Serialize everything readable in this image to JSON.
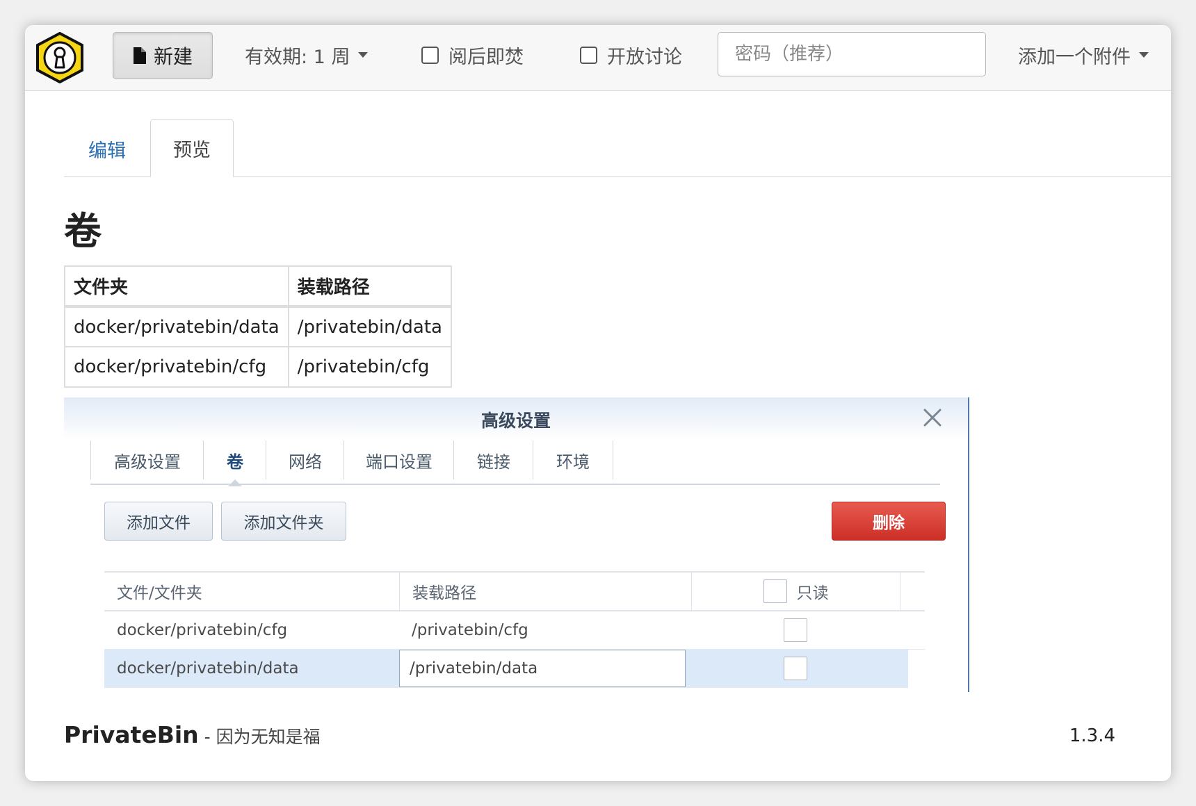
{
  "navbar": {
    "new_label": "新建",
    "expire_label": "有效期: 1 周",
    "burn_label": "阅后即焚",
    "discussion_label": "开放讨论",
    "password_placeholder": "密码（推荐）",
    "attach_label": "添加一个附件"
  },
  "tabs": {
    "edit": "编辑",
    "preview": "预览"
  },
  "preview": {
    "heading": "卷",
    "table": {
      "headers": [
        "文件夹",
        "装载路径"
      ],
      "rows": [
        [
          "docker/privatebin/data",
          "/privatebin/data"
        ],
        [
          "docker/privatebin/cfg",
          "/privatebin/cfg"
        ]
      ]
    }
  },
  "dialog": {
    "title": "高级设置",
    "tabs": [
      "高级设置",
      "卷",
      "网络",
      "端口设置",
      "链接",
      "环境"
    ],
    "active_tab": "卷",
    "add_file": "添加文件",
    "add_folder": "添加文件夹",
    "delete": "删除",
    "columns": [
      "文件/文件夹",
      "装载路径",
      "只读"
    ],
    "rows": [
      {
        "source": "docker/privatebin/cfg",
        "mount": "/privatebin/cfg",
        "readonly": false,
        "selected": false
      },
      {
        "source": "docker/privatebin/data",
        "mount": "/privatebin/data",
        "readonly": false,
        "selected": true
      }
    ]
  },
  "footer": {
    "brand": "PrivateBin",
    "tagline": " - 因为无知是福",
    "version": "1.3.4"
  },
  "colors": {
    "link_blue": "#2a6fb4",
    "delete_red": "#d43a30",
    "selected_row": "#dce9f8",
    "logo_yellow": "#f5d514"
  }
}
